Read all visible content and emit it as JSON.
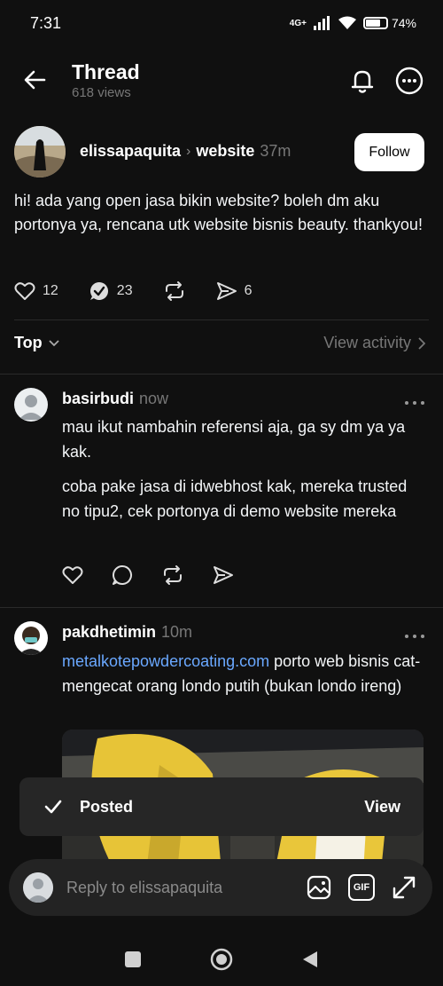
{
  "status": {
    "time": "7:31",
    "network": "4G+",
    "battery": "74%",
    "battery_level": 0.74
  },
  "header": {
    "title": "Thread",
    "views": "618 views"
  },
  "post": {
    "username": "elissapaquita",
    "topic": "website",
    "time": "37m",
    "follow_label": "Follow",
    "text": "hi! ada yang open jasa bikin website? boleh dm aku portonya ya, rencana utk website bisnis beauty. thankyou!",
    "likes": "12",
    "replies": "23",
    "shares": "6"
  },
  "sort": {
    "label": "Top",
    "view_activity": "View activity"
  },
  "replies": [
    {
      "username": "basirbudi",
      "time": "now",
      "paragraphs": [
        "mau ikut nambahin referensi aja,  ga sy dm ya ya kak.",
        "coba pake jasa di idwebhost kak, mereka trusted no tipu2, cek portonya di demo website mereka"
      ]
    },
    {
      "username": "pakdhetimin",
      "time": "10m",
      "link": "metalkotepowdercoating.com",
      "text": " porto web bisnis cat-mengecat orang londo putih (bukan londo ireng)"
    }
  ],
  "toast": {
    "text": "Posted",
    "action": "View"
  },
  "composer": {
    "placeholder": "Reply to elissapaquita",
    "gif_label": "GIF"
  },
  "colors": {
    "background": "#101010",
    "link": "#6aa8ff",
    "muted": "#777777"
  }
}
